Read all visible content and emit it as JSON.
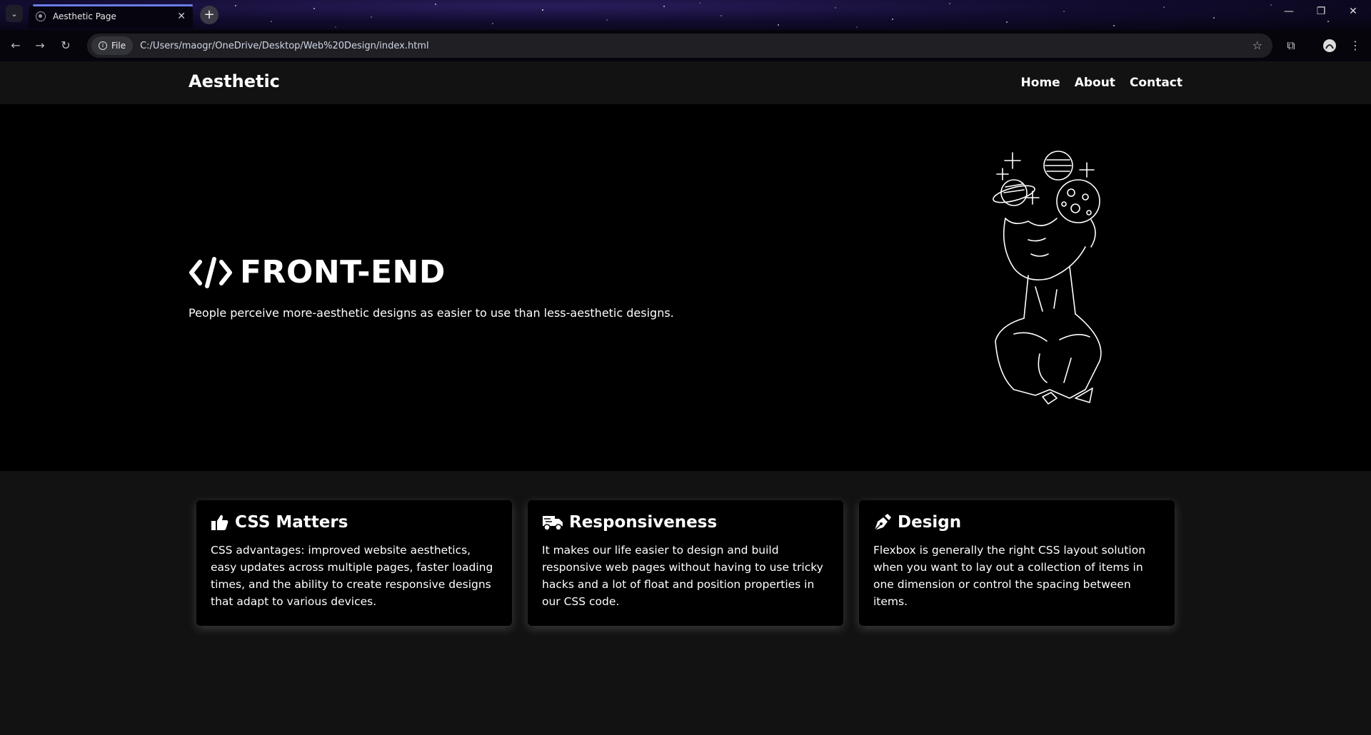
{
  "browser": {
    "tab_title": "Aesthetic Page",
    "tab_close": "✕",
    "new_tab": "+",
    "omnibox_chip": "File",
    "url": "C:/Users/maogr/OneDrive/Desktop/Web%20Design/index.html",
    "window_controls": [
      "—",
      "❐",
      "✕"
    ]
  },
  "header": {
    "brand": "Aesthetic",
    "nav": [
      "Home",
      "About",
      "Contact"
    ]
  },
  "hero": {
    "title": "FRONT-END",
    "subtitle": "People perceive more-aesthetic designs as easier to use than less-aesthetic designs.",
    "icon": "code-icon",
    "art_icon": "cosmic-head-illustration"
  },
  "cards": [
    {
      "icon": "thumbs-up-icon",
      "title": "CSS Matters",
      "text": "CSS advantages: improved website aesthetics, easy updates across multiple pages, faster loading times, and the ability to create responsive designs that adapt to various devices."
    },
    {
      "icon": "truck-icon",
      "title": "Responsiveness",
      "text": "It makes our life easier to design and build responsive web pages without having to use tricky hacks and a lot of float and position properties in our CSS code."
    },
    {
      "icon": "pen-nib-icon",
      "title": "Design",
      "text": "Flexbox is generally the right CSS layout solution when you want to lay out a collection of items in one dimension or control the spacing between items."
    }
  ],
  "colors": {
    "page_bg": "#121212",
    "hero_bg": "#000000",
    "text": "#ffffff",
    "tab_accent": "#6b7de8"
  }
}
